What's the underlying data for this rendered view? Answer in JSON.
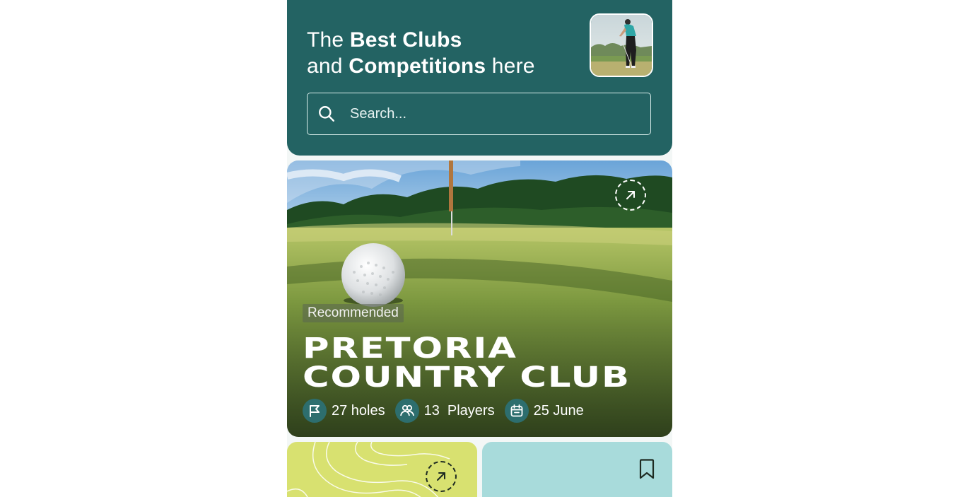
{
  "header": {
    "line1_prefix": "The ",
    "line1_bold": "Best Clubs",
    "line2_prefix": "and ",
    "line2_bold": "Competitions",
    "line2_suffix": " here",
    "avatar_icon": "golfer-photo",
    "background_color": "#236363"
  },
  "search": {
    "placeholder": "Search...",
    "icon": "search-icon"
  },
  "featured": {
    "badge": "Recommended",
    "name": "Pretoria Country Club",
    "stats": {
      "holes": "27 holes",
      "players_count": "13",
      "players_label": "Players",
      "date": "25 June"
    },
    "icons": [
      "flag-icon",
      "users-icon",
      "calendar-icon",
      "arrow-up-right-icon"
    ]
  },
  "cards": {
    "left_color": "#d8e170",
    "right_color": "#a8dbdb",
    "left_icon": "arrow-up-right-icon",
    "right_icon": "bookmark-icon"
  }
}
